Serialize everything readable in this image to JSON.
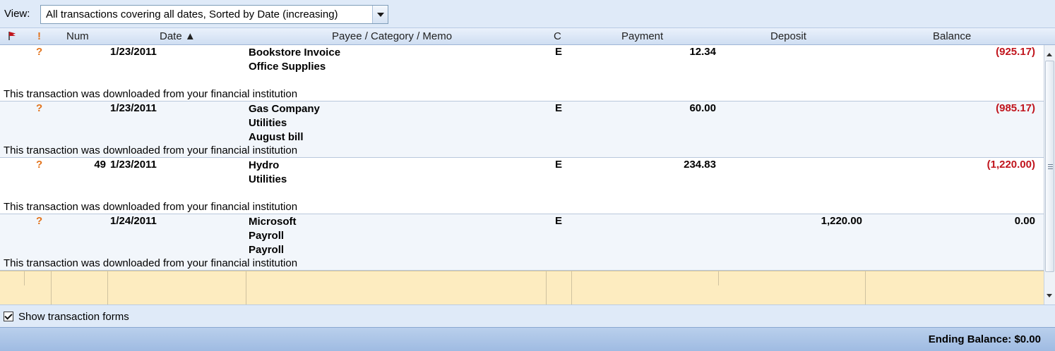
{
  "view": {
    "label": "View:",
    "selected": "All transactions covering all dates, Sorted by Date (increasing)"
  },
  "columns": {
    "flag": "",
    "action": "!",
    "num": "Num",
    "date": "Date ▲",
    "payee": "Payee / Category / Memo",
    "c": "C",
    "payment": "Payment",
    "deposit": "Deposit",
    "balance": "Balance"
  },
  "transactions": [
    {
      "status": "?",
      "num": "",
      "date": "1/23/2011",
      "payee": "Bookstore Invoice",
      "category": "Office Supplies",
      "memo": "",
      "c": "E",
      "payment": "12.34",
      "deposit": "",
      "balance": "(925.17)",
      "note": "This transaction was downloaded from your financial institution"
    },
    {
      "status": "?",
      "num": "",
      "date": "1/23/2011",
      "payee": "Gas Company",
      "category": "Utilities",
      "memo": "August bill",
      "c": "E",
      "payment": "60.00",
      "deposit": "",
      "balance": "(985.17)",
      "note": "This transaction was downloaded from your financial institution"
    },
    {
      "status": "?",
      "num": "49",
      "date": "1/23/2011",
      "payee": "Hydro",
      "category": "Utilities",
      "memo": "",
      "c": "E",
      "payment": "234.83",
      "deposit": "",
      "balance": "(1,220.00)",
      "note": "This transaction was downloaded from your financial institution"
    },
    {
      "status": "?",
      "num": "",
      "date": "1/24/2011",
      "payee": "Microsoft",
      "category": "Payroll",
      "memo": "Payroll",
      "c": "E",
      "payment": "",
      "deposit": "1,220.00",
      "balance": "0.00",
      "note": "This transaction was downloaded from your financial institution"
    }
  ],
  "forms": {
    "label": "Show transaction forms",
    "checked": true
  },
  "footer": {
    "ending_balance": "Ending Balance: $0.00"
  },
  "colors": {
    "negative": "#c0141c",
    "status": "#e2731c",
    "new_row": "#fdecc0"
  }
}
